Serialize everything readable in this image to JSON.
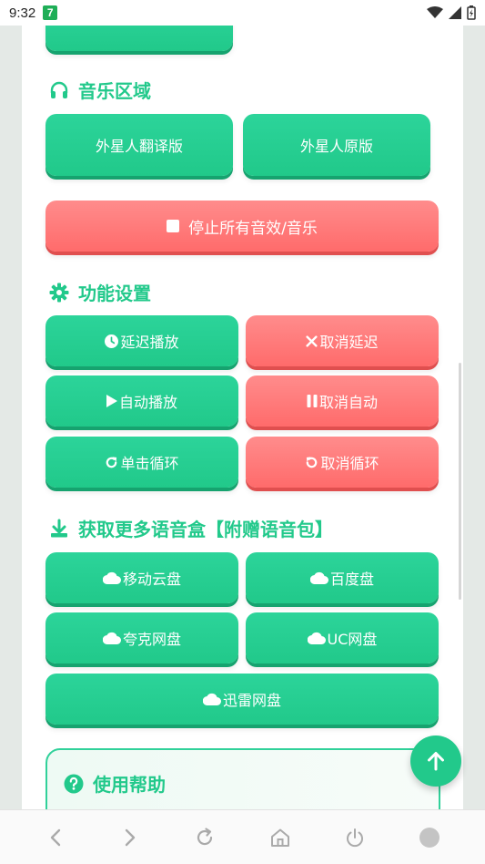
{
  "status_bar": {
    "time": "9:32",
    "app_badge": "7"
  },
  "sections": {
    "music": {
      "title": "音乐区域"
    },
    "settings": {
      "title": "功能设置"
    },
    "download": {
      "title": "获取更多语音盒【附赠语音包】"
    },
    "help": {
      "title": "使用帮助"
    }
  },
  "music_buttons": {
    "translated": "外星人翻译版",
    "original": "外星人原版",
    "stop_all": "停止所有音效/音乐"
  },
  "settings_buttons": {
    "delay_play": "延迟播放",
    "cancel_delay": "取消延迟",
    "auto_play": "自动播放",
    "cancel_auto": "取消自动",
    "single_loop": "单击循环",
    "cancel_loop": "取消循环"
  },
  "download_buttons": {
    "mobile_cloud": "移动云盘",
    "baidu": "百度盘",
    "quark": "夸克网盘",
    "uc": "UC网盘",
    "xunlei": "迅雷网盘"
  },
  "colors": {
    "green": "#22c98b",
    "red": "#ff6b6b",
    "page_bg": "#ffffff",
    "outer_bg": "#e4e9e6"
  },
  "icons": {
    "music": "headphones-icon",
    "settings": "gear-icon",
    "download": "download-icon",
    "help": "question-circle-icon",
    "stop": "stop-square-icon",
    "delay": "clock-icon",
    "cancel": "close-icon",
    "play": "play-icon",
    "pause": "pause-icon",
    "redo": "redo-icon",
    "undo": "undo-icon",
    "cloud": "cloud-icon",
    "back_to_top": "arrow-up-icon"
  }
}
